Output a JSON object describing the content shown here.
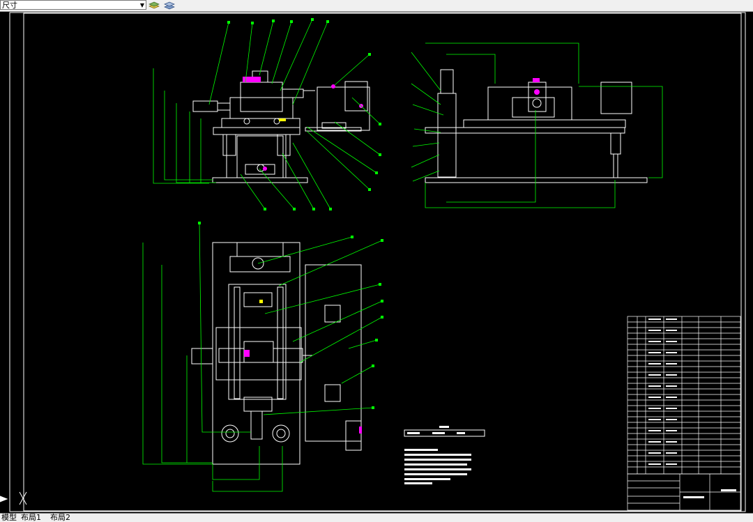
{
  "toolbar": {
    "dimension_style": "尺寸"
  },
  "layout_tabs": [
    {
      "label": "模型"
    },
    {
      "label": "布局1"
    },
    {
      "label": "布局2"
    }
  ],
  "colors": {
    "background": "#000000",
    "drawing_lines": "#ffffff",
    "leader_lines": "#00ff00",
    "highlight": "#ff00ff"
  }
}
